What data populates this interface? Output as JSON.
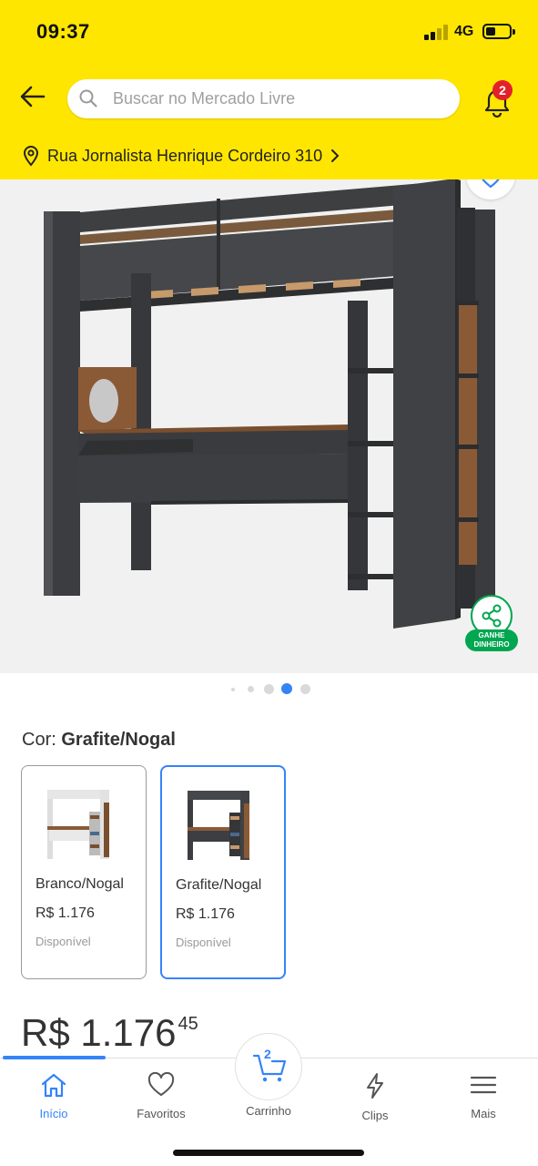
{
  "status_bar": {
    "time": "09:37",
    "network": "4G"
  },
  "header": {
    "search_placeholder": "Buscar no Mercado Livre",
    "notifications_count": "2",
    "address": "Rua Jornalista Henrique Cordeiro 310"
  },
  "share": {
    "label_line1": "GANHE",
    "label_line2": "DINHEIRO"
  },
  "gallery": {
    "active_index": 3
  },
  "color": {
    "label": "Cor:",
    "selected": "Grafite/Nogal"
  },
  "variants": [
    {
      "name": "Branco/Nogal",
      "price": "R$ 1.176",
      "availability": "Disponível"
    },
    {
      "name": "Grafite/Nogal",
      "price": "R$ 1.176",
      "availability": "Disponível"
    }
  ],
  "price": {
    "main": "R$ 1.176",
    "cents": "45"
  },
  "tabbar": {
    "items": [
      {
        "label": "Início",
        "icon": "home-icon"
      },
      {
        "label": "Favoritos",
        "icon": "heart-icon"
      },
      {
        "label": "Carrinho",
        "icon": "cart-icon"
      },
      {
        "label": "Clips",
        "icon": "lightning-icon"
      },
      {
        "label": "Mais",
        "icon": "menu-icon"
      }
    ],
    "cart_count": "2"
  },
  "colors": {
    "header": "#FFE600",
    "accent": "#3483fa",
    "green": "#00a650",
    "badge": "#e3212b"
  }
}
